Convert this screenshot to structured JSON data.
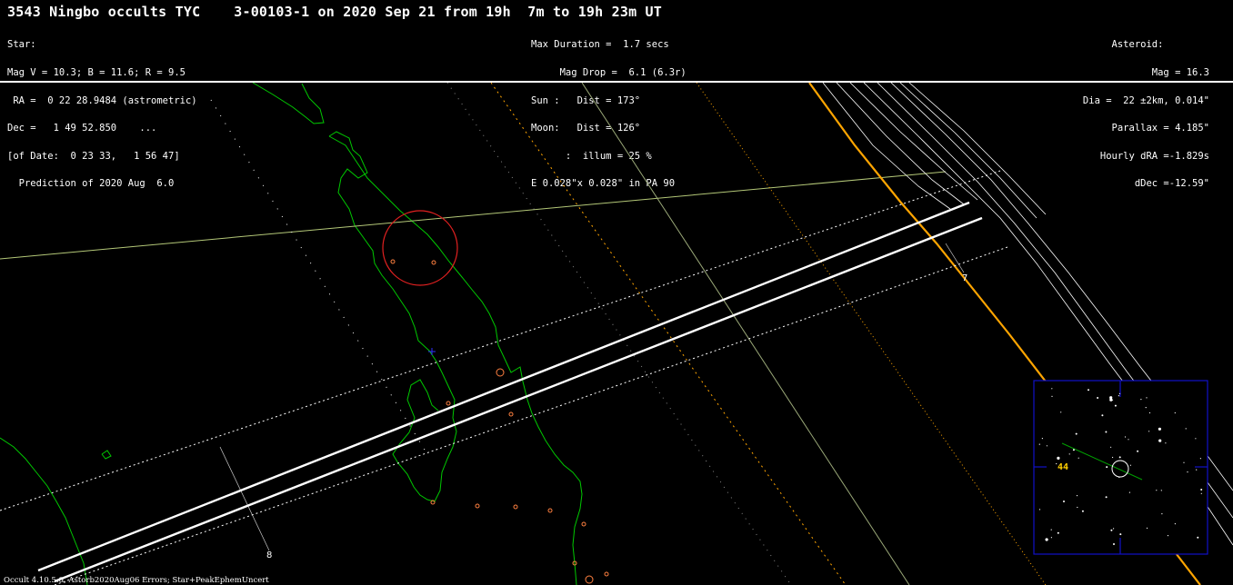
{
  "header": {
    "title": "3543 Ningbo occults TYC    3-00103-1 on 2020 Sep 21 from 19h  7m to 19h 23m UT",
    "star": {
      "heading": "Star:",
      "mags": "Mag V = 10.3; B = 11.6; R = 9.5",
      "ra": " RA =  0 22 28.9484 (astrometric)",
      "dec": "Dec =   1 49 52.850    ...",
      "of_date": "[of Date:  0 23 33,   1 56 47]",
      "prediction": "  Prediction of 2020 Aug  6.0"
    },
    "event": {
      "max_duration": "Max Duration =  1.7 secs",
      "mag_drop": "     Mag Drop =  6.1 (6.3r)",
      "sun": "Sun :   Dist = 173°",
      "moon": "Moon:   Dist = 126°",
      "illum": "      :  illum = 25 %",
      "ellipse": "E 0.028\"x 0.028\" in PA 90"
    },
    "asteroid": {
      "heading": "Asteroid:        ",
      "mag": "Mag = 16.3",
      "dia": "Dia =  22 ±2km, 0.014\"",
      "parallax": "Parallax = 4.185\"",
      "hourly_dra": "Hourly dRA =-1.829s",
      "ddec": "dDec =-12.59\""
    }
  },
  "map": {
    "time_labels": [
      "7",
      "8"
    ],
    "colors": {
      "background": "#000000",
      "coastline": "#00c800",
      "path": "#ffffff",
      "sun_limit": "#ffa500",
      "moon_line": "#b4c878",
      "site_circle": "#e02020",
      "cities": "#ff8040",
      "finder_frame": "#1010c8"
    }
  },
  "finder": {
    "field_label": "44"
  },
  "footer": "Occult 4.10.5.0, Astorb2020Aug06 Errors; Star+PeakEphemUncert"
}
